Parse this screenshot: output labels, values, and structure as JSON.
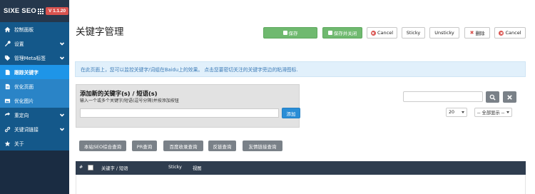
{
  "brand": {
    "name": "SIXE SEO",
    "version": "V 1.1.20"
  },
  "sidebar": {
    "items": [
      {
        "label": "控制面板",
        "icon": "home-icon",
        "type": "group"
      },
      {
        "label": "设置",
        "icon": "wrench-icon",
        "type": "group",
        "chevron": true
      },
      {
        "label": "管理Meta标签",
        "icon": "tag-icon",
        "type": "group",
        "chevron": true
      },
      {
        "label": "跟踪关键字",
        "icon": "document-icon",
        "type": "child",
        "active": true
      },
      {
        "label": "优化页面",
        "icon": "file-icon",
        "type": "child"
      },
      {
        "label": "优化图片",
        "icon": "image-icon",
        "type": "child"
      },
      {
        "label": "重定向",
        "icon": "redirect-icon",
        "type": "group",
        "chevron": true
      },
      {
        "label": "关键词链接",
        "icon": "link-icon",
        "type": "group",
        "chevron": true
      },
      {
        "label": "关于",
        "icon": "star-icon",
        "type": "group"
      }
    ]
  },
  "page": {
    "title": "关键字管理"
  },
  "toolbar": {
    "save_label": "保存",
    "save_close_label": "保存并关闭",
    "cancel_label": "Cancel",
    "sticky_label": "Sticky",
    "unsticky_label": "Unsticky",
    "delete_label": "删除",
    "cancel2_label": "Cancel"
  },
  "info": {
    "text": "在此页面上，您可以监控关键字/词组在Baidu上的效果。 点击您要密切关注的关键字旁边的粘滞图标."
  },
  "add_panel": {
    "title": "添加新的关键字(s) / 短语(s)",
    "help": "输入一个或多个关键字/短语(逗号分隔)并按添加按钮",
    "input_value": "",
    "button_label": "添加"
  },
  "filters": {
    "search_value": "",
    "page_size": "20",
    "display_filter": "-- 全部显示 --"
  },
  "query_buttons": [
    "本站SEO综合查询",
    "PR查询",
    "百度收录查询",
    "反链查询",
    "友情链接查询"
  ],
  "table": {
    "columns": {
      "num": "#",
      "keyword": "关键字 / 短语",
      "sticky": "Sticky",
      "view": "视图"
    }
  },
  "colors": {
    "sidebar_bg": "#1a2c42",
    "group_item": "#14588a",
    "child_item": "#2a84c7",
    "active_item": "#1e95e8",
    "save_green": "#6fb96f",
    "version_badge": "#d9534f",
    "info_bg": "#e1f0fb",
    "table_header": "#2f3d4f"
  }
}
